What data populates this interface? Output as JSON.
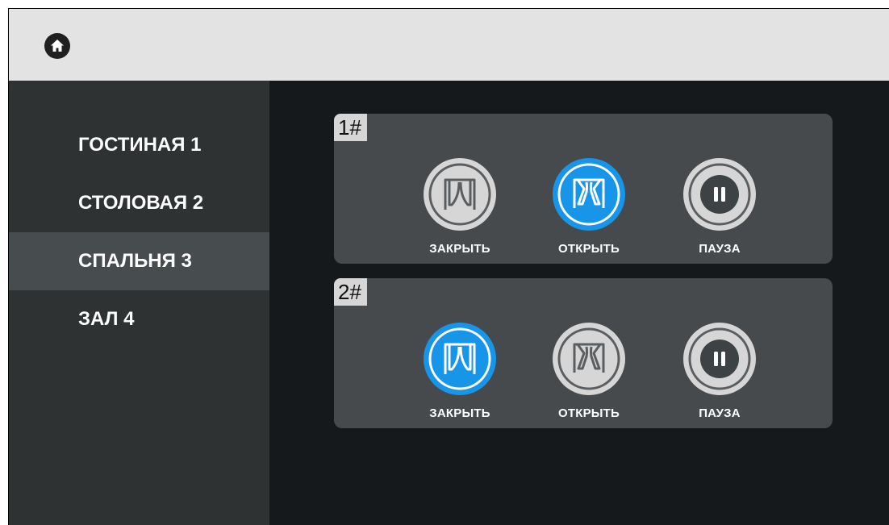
{
  "header": {
    "home_icon": "home-icon"
  },
  "rooms": [
    {
      "label": "ГОСТИНАЯ 1",
      "active": false
    },
    {
      "label": "СТОЛОВАЯ 2",
      "active": false
    },
    {
      "label": "СПАЛЬНЯ 3",
      "active": true
    },
    {
      "label": "ЗАЛ 4",
      "active": false
    }
  ],
  "curtains": [
    {
      "number": "1#",
      "controls": [
        {
          "label": "ЗАКРЫТЬ",
          "icon": "curtain-close-icon",
          "active": false
        },
        {
          "label": "ОТКРЫТЬ",
          "icon": "curtain-open-icon",
          "active": true
        },
        {
          "label": "ПАУЗА",
          "icon": "pause-icon",
          "active": false
        }
      ]
    },
    {
      "number": "2#",
      "controls": [
        {
          "label": "ЗАКРЫТЬ",
          "icon": "curtain-close-icon",
          "active": true
        },
        {
          "label": "ОТКРЫТЬ",
          "icon": "curtain-open-icon",
          "active": false
        },
        {
          "label": "ПАУЗА",
          "icon": "pause-icon",
          "active": false
        }
      ]
    }
  ],
  "colors": {
    "accent": "#1795e9",
    "sidebar_bg": "#2e3233",
    "sidebar_active": "#474c4f",
    "panel_bg": "#464a4d",
    "content_bg": "#15191c",
    "topbar_bg": "#e3e3e3"
  }
}
